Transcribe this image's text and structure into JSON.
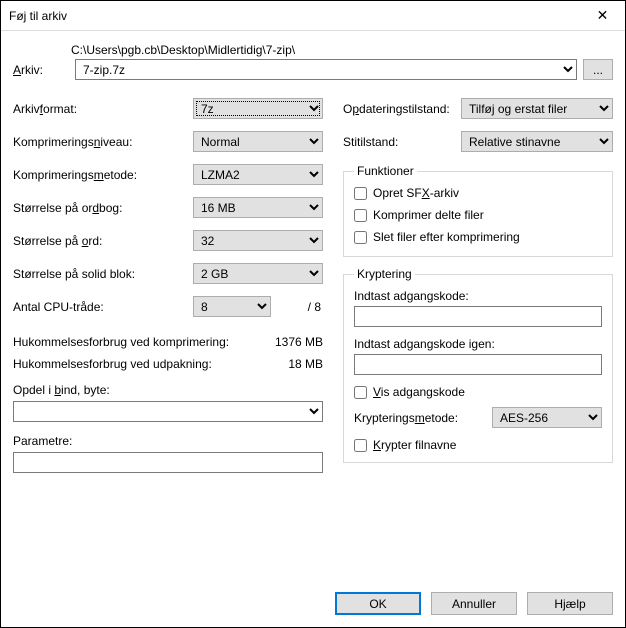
{
  "window": {
    "title": "Føj til arkiv"
  },
  "archive": {
    "label_html": "Arkiv:",
    "path": "C:\\Users\\pgb.cb\\Desktop\\Midlertidig\\7-zip\\",
    "name": "7-zip.7z",
    "browse": "..."
  },
  "left": {
    "format_label": "Arkivformat:",
    "format_value": "7z",
    "level_label": "Komprimeringsniveau:",
    "level_value": "Normal",
    "method_label": "Komprimeringsmetode:",
    "method_value": "LZMA2",
    "dict_label": "Størrelse på ordbog:",
    "dict_value": "16 MB",
    "word_label": "Størrelse på ord:",
    "word_value": "32",
    "solid_label": "Størrelse på solid blok:",
    "solid_value": "2 GB",
    "cpu_label": "Antal CPU-tråde:",
    "cpu_value": "8",
    "cpu_total": "/ 8",
    "mem_comp_label": "Hukommelsesforbrug ved komprimering:",
    "mem_comp_value": "1376 MB",
    "mem_dec_label": "Hukommelsesforbrug ved udpakning:",
    "mem_dec_value": "18 MB",
    "split_label": "Opdel i bind, byte:",
    "params_label": "Parametre:"
  },
  "right": {
    "update_label": "Opdateringstilstand:",
    "update_value": "Tilføj og erstat filer",
    "pathmode_label": "Stitilstand:",
    "pathmode_value": "Relative stinavne",
    "options_legend": "Funktioner",
    "opt_sfx": "Opret SFX-arkiv",
    "opt_shared": "Komprimer delte filer",
    "opt_delete": "Slet filer efter komprimering",
    "enc_legend": "Kryptering",
    "enc_pw_label": "Indtast adgangskode:",
    "enc_pw2_label": "Indtast adgangskode igen:",
    "enc_show": "Vis adgangskode",
    "enc_method_label": "Krypteringsmetode:",
    "enc_method_value": "AES-256",
    "enc_names": "Krypter filnavne"
  },
  "buttons": {
    "ok": "OK",
    "cancel": "Annuller",
    "help": "Hjælp"
  }
}
